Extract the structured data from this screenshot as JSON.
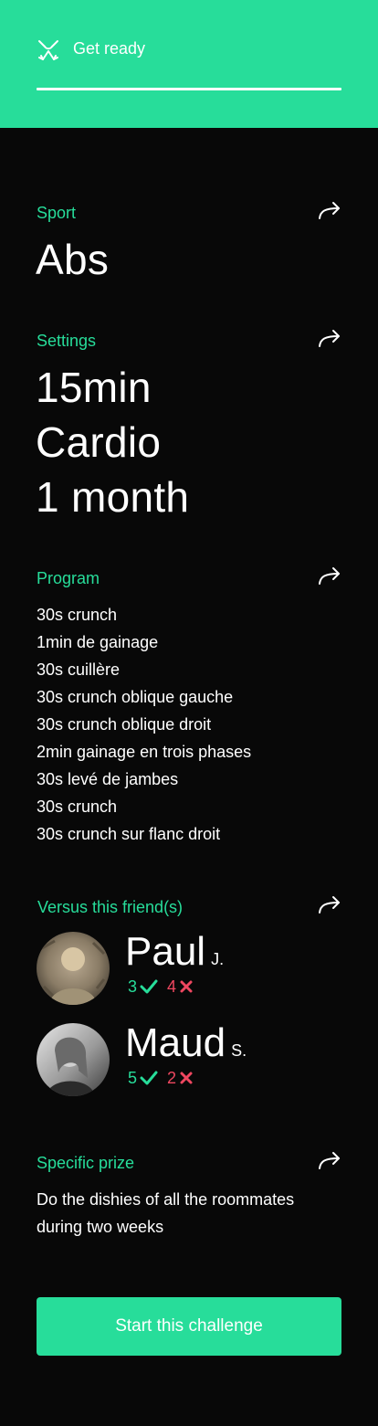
{
  "colors": {
    "accent": "#27dd9a",
    "background": "#080808",
    "loss": "#ef4760",
    "text": "#ffffff"
  },
  "header": {
    "title": "Get ready",
    "icon": "crossed-arrows-icon"
  },
  "sport": {
    "label": "Sport",
    "value": "Abs",
    "action_icon": "share-arrow-icon"
  },
  "settings": {
    "label": "Settings",
    "lines": [
      "15min",
      "Cardio",
      "1 month"
    ],
    "action_icon": "share-arrow-icon"
  },
  "program": {
    "label": "Program",
    "action_icon": "share-arrow-icon",
    "items": [
      "30s crunch",
      "1min de gainage",
      "30s cuillère",
      "30s crunch oblique gauche",
      "30s crunch oblique droit",
      "2min gainage en trois phases",
      "30s levé de jambes",
      "30s crunch",
      "30s crunch sur flanc droit"
    ]
  },
  "versus": {
    "label": "Versus this friend(s)",
    "action_icon": "share-arrow-icon",
    "friends": [
      {
        "name": "Paul",
        "initial": "J.",
        "wins": "3",
        "losses": "4"
      },
      {
        "name": "Maud",
        "initial": "S.",
        "wins": "5",
        "losses": "2"
      }
    ]
  },
  "prize": {
    "label": "Specific prize",
    "text": "Do the dishies of all the roommates during two weeks",
    "action_icon": "share-arrow-icon"
  },
  "cta": {
    "label": "Start this challenge"
  }
}
